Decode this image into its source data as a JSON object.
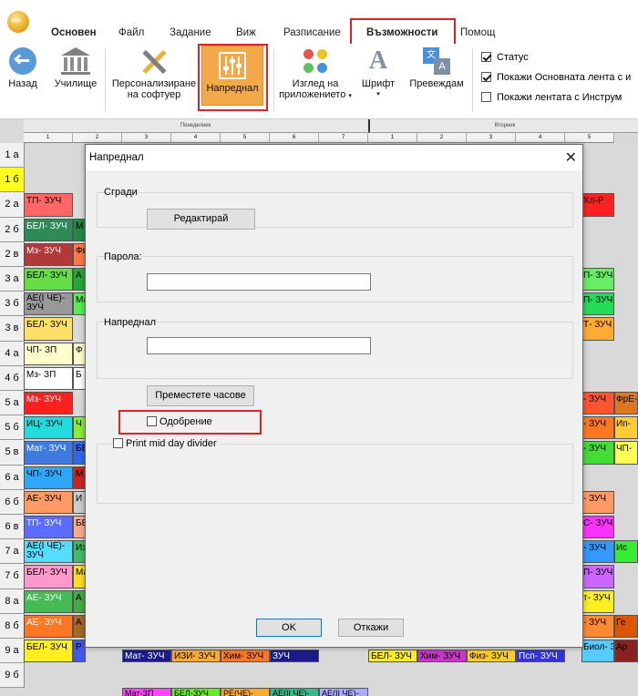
{
  "app": {
    "icon_text": "aSc"
  },
  "ribbon_tabs": [
    "Основен",
    "Файл",
    "Задание",
    "Виж",
    "Разписание",
    "Възможности",
    "Помощ"
  ],
  "ribbon": {
    "back": "Назад",
    "school": "Училище",
    "customize_line1": "Персонализиране",
    "customize_line2": "на софтуер",
    "advanced": "Напреднал",
    "look_line1": "Изглед на",
    "look_line2": "приложението",
    "font": "Шрифт",
    "translate": "Превеждам",
    "checks": [
      {
        "label": "Статус",
        "checked": true
      },
      {
        "label": "Покажи Основната лента с и",
        "checked": true
      },
      {
        "label": "Покажи лентата с Инструм",
        "checked": false
      }
    ]
  },
  "grid": {
    "day1": "Понеделник",
    "day2": "Вторник",
    "periods1": [
      "1",
      "2",
      "3",
      "4",
      "5",
      "6",
      "7"
    ],
    "periods2": [
      "1",
      "2",
      "3",
      "4",
      "5"
    ],
    "rows": [
      "1 а",
      "1 б",
      "2 а",
      "2 б",
      "2 в",
      "3 а",
      "3 б",
      "3 в",
      "4 а",
      "4 б",
      "5 а",
      "5 б",
      "5 в",
      "6 а",
      "6 б",
      "6 в",
      "7 а",
      "7 б",
      "8 а",
      "8 б",
      "9 а",
      "9 б"
    ],
    "left_cells": [
      [
        "",
        ""
      ],
      [
        "",
        ""
      ],
      [
        "ТП- ЗУЧ",
        ""
      ],
      [
        "БЕЛ- ЗУЧ",
        "М"
      ],
      [
        "Мз- ЗУЧ",
        "Фв"
      ],
      [
        "БЕЛ- ЗУЧ",
        "А"
      ],
      [
        "АЕ(І ЧЕ)- ЗУЧ",
        "Ма"
      ],
      [
        "БЕЛ- ЗУЧ",
        ""
      ],
      [
        "ЧП- ЗП",
        "Ф"
      ],
      [
        "Мз- ЗП",
        "Б"
      ],
      [
        "Мз- ЗУЧ",
        ""
      ],
      [
        "ИЦ- ЗУЧ",
        "Ч"
      ],
      [
        "Мат- ЗУЧ",
        "БЕ"
      ],
      [
        "ЧП- ЗУЧ",
        "М"
      ],
      [
        "АЕ- ЗУЧ",
        "И"
      ],
      [
        "ТП- ЗУЧ",
        "БЕ"
      ],
      [
        "АЕ(І ЧЕ)- ЗУЧ",
        "Из"
      ],
      [
        "БЕЛ- ЗУЧ",
        "Ма"
      ],
      [
        "АЕ- ЗУЧ",
        "А"
      ],
      [
        "АЕ- ЗУЧ",
        "А"
      ],
      [
        "БЕЛ- ЗУЧ",
        "Р"
      ],
      [
        "",
        ""
      ]
    ],
    "right_cells": [
      [
        "",
        ""
      ],
      [
        "",
        ""
      ],
      [
        "Хл-Р",
        ""
      ],
      [
        "",
        ""
      ],
      [
        "",
        ""
      ],
      [
        "П- ЗУЧ",
        ""
      ],
      [
        "П- ЗУЧ",
        ""
      ],
      [
        "Т- ЗУЧ",
        ""
      ],
      [
        "",
        ""
      ],
      [
        "",
        ""
      ],
      [
        "- ЗУЧ",
        "ФрЕ-"
      ],
      [
        "- ЗУЧ",
        "Ип-"
      ],
      [
        "- ЗУЧ",
        "ЧП-"
      ],
      [
        "",
        ""
      ],
      [
        "- ЗУЧ",
        ""
      ],
      [
        "С- ЗУЧ",
        ""
      ],
      [
        "- ЗУЧ",
        "Ис"
      ],
      [
        "П- ЗУЧ",
        ""
      ],
      [
        "т- ЗУЧ",
        ""
      ],
      [
        "- ЗУЧ",
        "Ге"
      ],
      [
        "Биол- ЗУЧ",
        "Ар"
      ],
      [
        "",
        ""
      ]
    ],
    "row9a_mid": [
      "Мат- ЗУЧ",
      "ИЗИ- ЗУЧ",
      "Хим- ЗУЧ",
      "ЗУЧ",
      "БЕЛ- ЗУЧ",
      "Хим- ЗУЧ",
      "Физ- ЗУЧ",
      "Псп- ЗУЧ"
    ],
    "bottom_mid": [
      "Мат-ЗП",
      "БЕЛ-ЗУЧ",
      "РЕ(ЧЕ)-",
      "АЕ(ІІ ЧЕ)-",
      "АЕ(ІІ ЧЕ)-"
    ]
  },
  "dialog": {
    "title": "Напреднал",
    "buildings_label": "Сгради",
    "edit_button": "Редактирай",
    "password_label": "Парола:",
    "password_value": "",
    "advanced_label": "Напреднал",
    "advanced_value": "",
    "move_hours_button": "Преместете часове",
    "approval_label": "Одобрение",
    "approval_checked": false,
    "divider_label": "Print mid day divider",
    "divider_checked": false,
    "ok": "OK",
    "cancel": "Откажи"
  },
  "colors": {
    "highlight": "#d8242c",
    "active_button": "#f5a84a"
  }
}
